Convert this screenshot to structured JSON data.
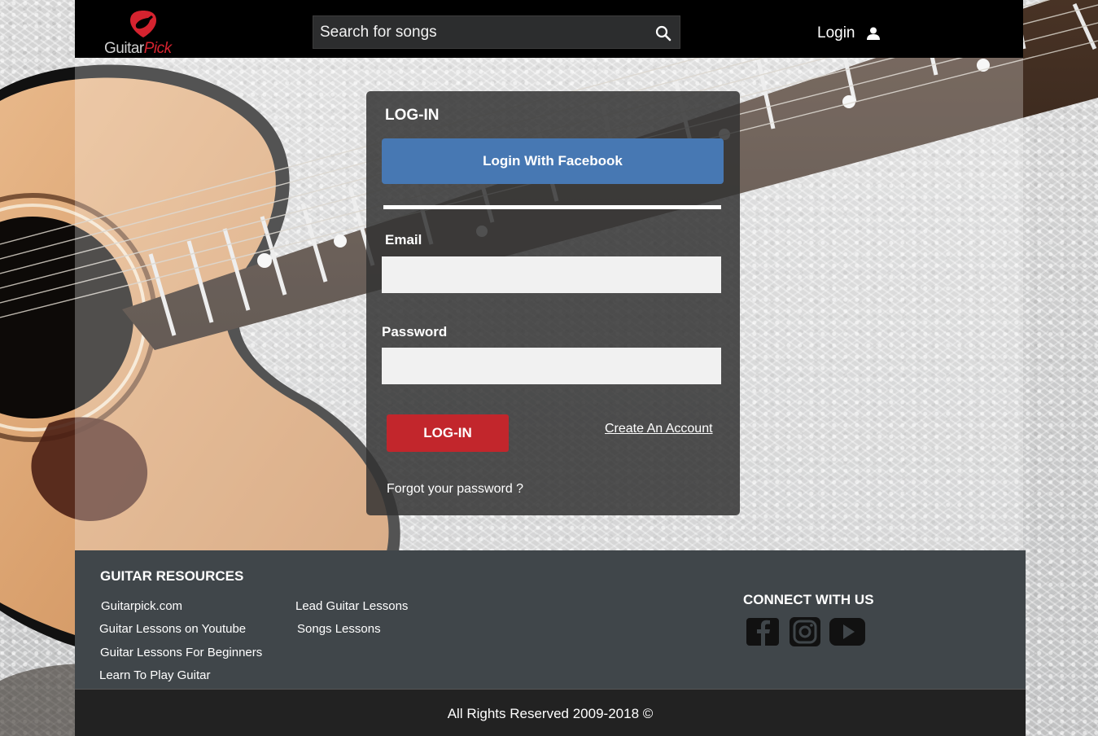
{
  "header": {
    "logo": {
      "brand_main": "Guitar",
      "brand_accent": "Pick",
      "accent_color": "#d5232f"
    },
    "search": {
      "placeholder": "Search for songs",
      "icon": "search-icon"
    },
    "login_label": "Login",
    "login_icon": "user-icon"
  },
  "login_form": {
    "title": "LOG-IN",
    "facebook_button": "Login With Facebook",
    "facebook_color": "#4778b3",
    "email_label": "Email",
    "email_value": "",
    "password_label": "Password",
    "password_value": "",
    "submit_button": "LOG-IN",
    "submit_color": "#c2262c",
    "create_account": "Create An Account",
    "forgot_password": "Forgot your password ?"
  },
  "footer": {
    "resources_heading": "GUITAR RESOURCES",
    "links": [
      "Guitarpick.com",
      "Guitar Lessons on Youtube",
      "Guitar Lessons For Beginners",
      "Learn To Play Guitar",
      "Lead Guitar Lessons",
      "Songs Lessons"
    ],
    "connect_heading": "CONNECT WITH US",
    "social": [
      "facebook-icon",
      "instagram-icon",
      "youtube-icon"
    ]
  },
  "copyright": "All Rights Reserved  2009-2018 ©"
}
